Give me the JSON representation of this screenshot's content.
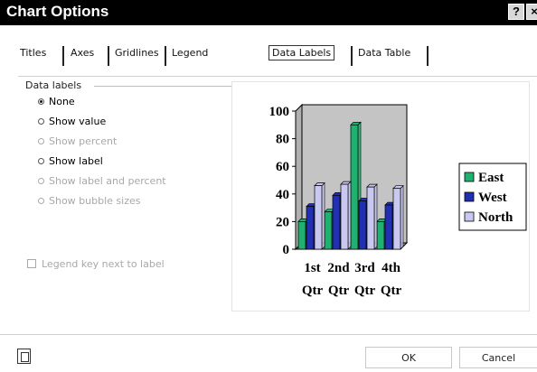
{
  "window": {
    "title": "Chart Options",
    "help_glyph": "?",
    "close_glyph": "×"
  },
  "tabs": [
    {
      "label": "Titles",
      "selected": false
    },
    {
      "label": "Axes",
      "selected": false
    },
    {
      "label": "Gridlines",
      "selected": false
    },
    {
      "label": "Legend",
      "selected": false
    },
    {
      "label": "Data Labels",
      "selected": true
    },
    {
      "label": "Data Table",
      "selected": false
    }
  ],
  "data_labels": {
    "group_title": "Data labels",
    "options": [
      {
        "label": "None",
        "selected": true,
        "enabled": true
      },
      {
        "label": "Show value",
        "selected": false,
        "enabled": true
      },
      {
        "label": "Show percent",
        "selected": false,
        "enabled": false
      },
      {
        "label": "Show label",
        "selected": false,
        "enabled": true
      },
      {
        "label": "Show label and percent",
        "selected": false,
        "enabled": false
      },
      {
        "label": "Show bubble sizes",
        "selected": false,
        "enabled": false
      }
    ],
    "legend_key": {
      "label": "Legend key next to label",
      "checked": false,
      "enabled": false
    }
  },
  "chart_data": {
    "type": "bar",
    "categories": [
      "1st Qtr",
      "2nd Qtr",
      "3rd Qtr",
      "4th Qtr"
    ],
    "series": [
      {
        "name": "East",
        "color": "#20b070",
        "values": [
          20,
          27,
          90,
          20
        ]
      },
      {
        "name": "West",
        "color": "#2030b0",
        "values": [
          31,
          39,
          35,
          32
        ]
      },
      {
        "name": "North",
        "color": "#c8c8f0",
        "values": [
          46,
          47,
          45,
          44
        ]
      }
    ],
    "ylim": [
      0,
      100
    ],
    "yticks": [
      0,
      20,
      40,
      60,
      80,
      100
    ],
    "grid": false,
    "legend_position": "right",
    "plot_area_color": "#c4c4c4"
  },
  "footer": {
    "ok_label": "OK",
    "cancel_label": "Cancel"
  }
}
